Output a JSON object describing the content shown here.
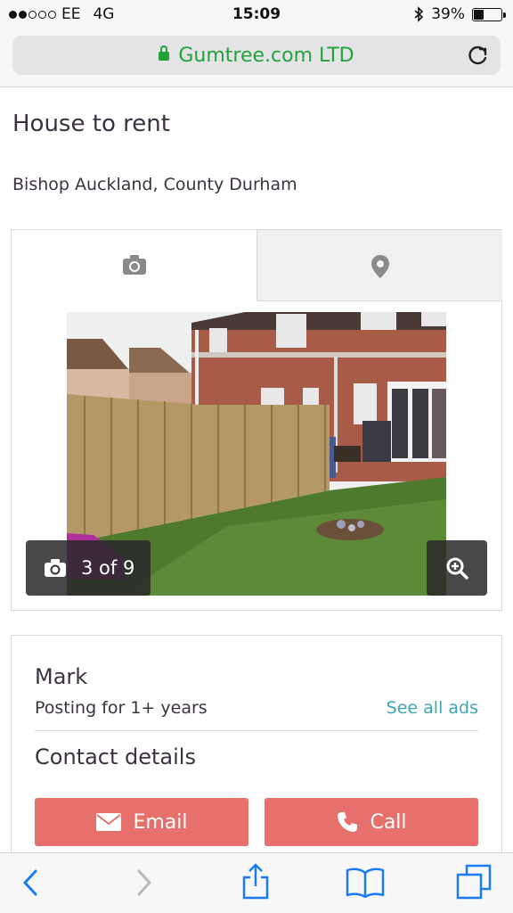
{
  "status_bar": {
    "carrier": "EE",
    "network": "4G",
    "time": "15:09",
    "battery": "39%",
    "battery_level": 0.39,
    "signal_bars": 2,
    "signal_total": 5
  },
  "browser": {
    "url_text": "Gumtree.com LTD",
    "icons": [
      "lock-icon",
      "reload-icon"
    ]
  },
  "listing": {
    "title": "House to rent",
    "location": "Bishop Auckland, County Durham"
  },
  "gallery": {
    "tabs": [
      "camera-icon",
      "map-pin-icon"
    ],
    "counter": "3 of 9"
  },
  "seller": {
    "name": "Mark",
    "posting": "Posting for 1+ years",
    "see_all": "See all ads",
    "contact_heading": "Contact details",
    "email_label": "Email",
    "call_label": "Call"
  },
  "toolbar": {
    "icons": [
      "back-icon",
      "forward-icon",
      "share-icon",
      "bookmarks-icon",
      "tabs-icon"
    ]
  },
  "colors": {
    "url_green": "#21a33a",
    "button_coral": "#e7706d",
    "link_teal": "#3fa5b1",
    "ios_blue": "#1a7cf5"
  }
}
